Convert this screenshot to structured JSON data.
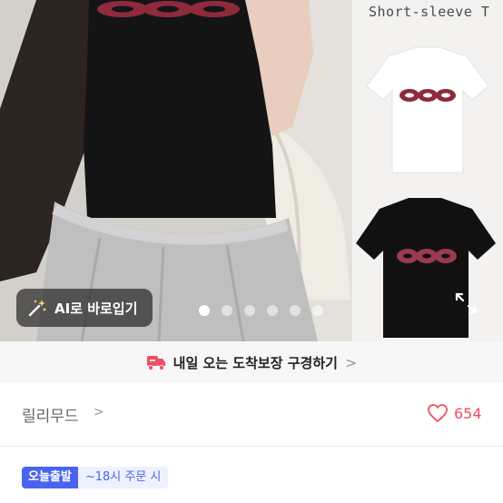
{
  "gallery": {
    "side_title": "Short-sleeve T",
    "slide_count": 6,
    "active_slide": 1,
    "ai_button_label": "AI로 바로입기"
  },
  "banner": {
    "text": "내일 오는 도착보장 구경하기",
    "chevron": ">"
  },
  "store": {
    "name": "릴리무드",
    "chevron": ">",
    "like_count": "654"
  },
  "shipping": {
    "badge_primary": "오늘출발",
    "badge_secondary": "~18시 주문 시"
  },
  "colors": {
    "accent_pink": "#ee4f61",
    "badge_blue": "#4a64f0",
    "logo_wine": "#8e2a3c"
  }
}
